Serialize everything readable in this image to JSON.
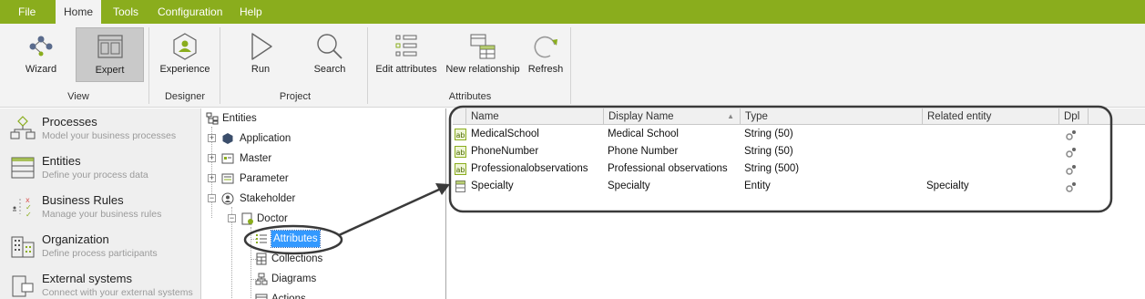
{
  "menu": {
    "items": [
      "File",
      "Home",
      "Tools",
      "Configuration",
      "Help"
    ],
    "active": "Home"
  },
  "ribbon": {
    "buttons": {
      "wizard": "Wizard",
      "expert": "Expert",
      "experience": "Experience",
      "run": "Run",
      "search": "Search",
      "edit_attributes": "Edit attributes",
      "new_relationship": "New relationship",
      "refresh": "Refresh"
    },
    "groups": {
      "view": "View",
      "designer": "Designer",
      "project": "Project",
      "attributes": "Attributes"
    }
  },
  "nav": [
    {
      "title": "Processes",
      "subtitle": "Model your business processes",
      "icon": "processes-icon"
    },
    {
      "title": "Entities",
      "subtitle": "Define your process data",
      "icon": "entities-icon"
    },
    {
      "title": "Business Rules",
      "subtitle": "Manage your business rules",
      "icon": "business-rules-icon"
    },
    {
      "title": "Organization",
      "subtitle": "Define process participants",
      "icon": "organization-icon"
    },
    {
      "title": "External systems",
      "subtitle": "Connect with your external systems",
      "icon": "external-systems-icon"
    }
  ],
  "tree": {
    "root": "Entities",
    "nodes": {
      "application": "Application",
      "master": "Master",
      "parameter": "Parameter",
      "stakeholder": "Stakeholder",
      "doctor": "Doctor",
      "attributes": "Attributes",
      "collections": "Collections",
      "diagrams": "Diagrams",
      "actions": "Actions"
    },
    "selected": "Attributes"
  },
  "grid": {
    "columns": [
      "Name",
      "Display Name",
      "Type",
      "Related entity",
      "Dpl"
    ],
    "sorted_column": "Display Name",
    "rows": [
      {
        "name": "MedicalSchool",
        "display": "Medical School",
        "type": "String (50)",
        "related": ""
      },
      {
        "name": "PhoneNumber",
        "display": "Phone Number",
        "type": "String (50)",
        "related": ""
      },
      {
        "name": "Professionalobservations",
        "display": "Professional observations",
        "type": "String (500)",
        "related": ""
      },
      {
        "name": "Specialty",
        "display": "Specialty",
        "type": "Entity",
        "related": "Specialty"
      }
    ]
  },
  "colors": {
    "brand": "#8aad1d",
    "selection": "#3399ff",
    "annotation": "#333333"
  }
}
